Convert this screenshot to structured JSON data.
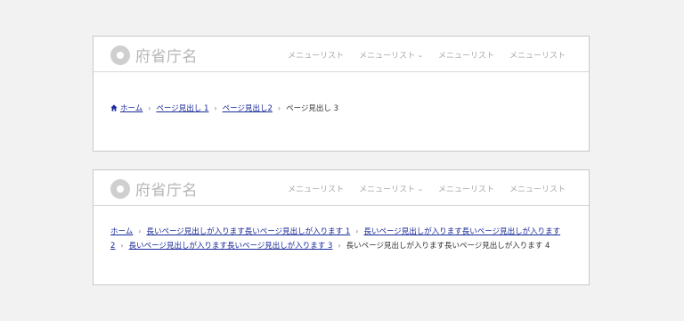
{
  "header": {
    "site_name": "府省庁名",
    "nav": [
      {
        "label": "メニューリスト",
        "has_dropdown": false
      },
      {
        "label": "メニューリスト",
        "has_dropdown": true
      },
      {
        "label": "メニューリスト",
        "has_dropdown": false
      },
      {
        "label": "メニューリスト",
        "has_dropdown": false
      }
    ],
    "dropdown_glyph": "⌄"
  },
  "example1": {
    "breadcrumbs": [
      "ホーム",
      "ページ見出し 1",
      "ページ見出し2"
    ],
    "current": "ページ見出し 3"
  },
  "example2": {
    "breadcrumbs": [
      "ホーム",
      "長いページ見出しが入ります長いページ見出しが入ります 1",
      "長いページ見出しが入ります長いページ見出しが入ります 2",
      "長いページ見出しが入ります長いページ見出しが入ります 3"
    ],
    "current": "長いページ見出しが入ります長いページ見出しが入ります 4"
  },
  "separator": "›",
  "colors": {
    "link": "#1a2a9a",
    "background": "#f2f2f2",
    "muted": "#a8a8a8"
  },
  "icons": {
    "home": "home-icon",
    "logo": "logo-mark-icon"
  }
}
